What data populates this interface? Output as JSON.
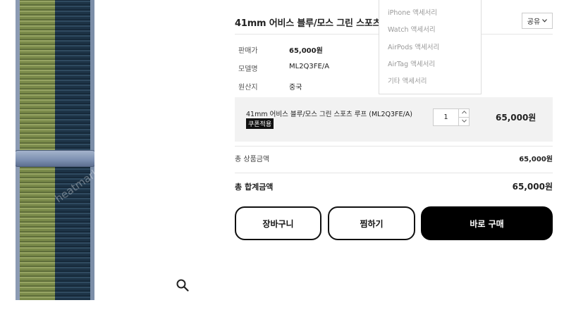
{
  "product": {
    "title": "41mm 어비스 블루/모스 그린 스포츠 루프 (ML2Q3FE/A)",
    "image_watermark": "heatmarket"
  },
  "share": {
    "label": "공유",
    "icon": "chevron-down-icon"
  },
  "info": [
    {
      "label": "판매가",
      "value": "65,000원"
    },
    {
      "label": "모델명",
      "value": "ML2Q3FE/A"
    },
    {
      "label": "원산지",
      "value": "중국"
    }
  ],
  "category_menu": {
    "items": [
      "iPhone 액세서리",
      "Watch 액세서리",
      "AirPods 액세서리",
      "AirTag 액세서리",
      "기타 액세서리"
    ]
  },
  "selected_option": {
    "name": "41mm 어비스 블루/모스 그린 스포츠 루프 (ML2Q3FE/A)",
    "coupon_badge": "쿠폰적용",
    "quantity": "1",
    "price": "65,000원"
  },
  "totals": {
    "product_total_label": "총 상품금액",
    "product_total_value": "65,000원",
    "grand_total_label": "총 합계금액",
    "grand_total_value": "65,000원"
  },
  "actions": {
    "cart_label": "장바구니",
    "wish_label": "찜하기",
    "buy_label": "바로 구매"
  },
  "colors": {
    "band_green": "#7a8a4a",
    "band_blue": "#1d3346",
    "buckle": "#8c9bb3",
    "buy_button": "#000000",
    "option_box_bg": "#f2f2f2"
  }
}
